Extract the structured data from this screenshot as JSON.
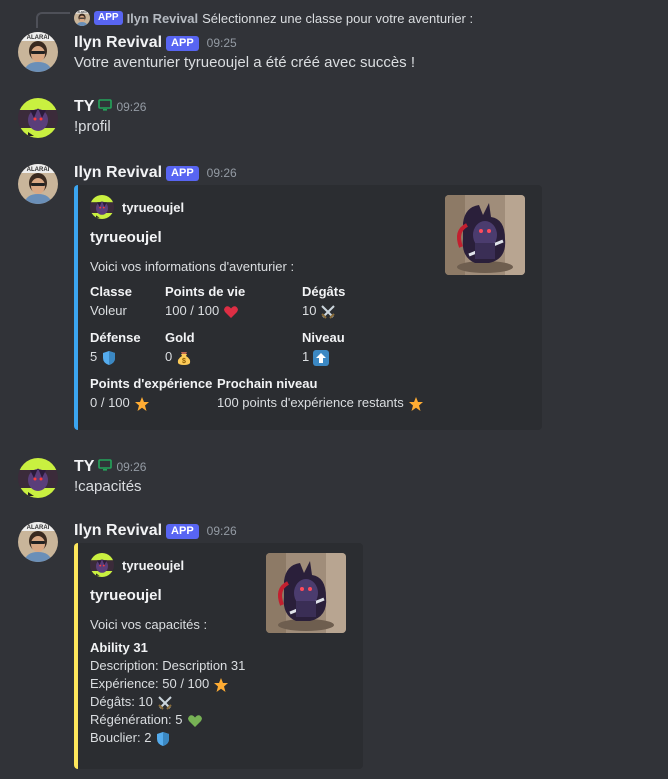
{
  "reply": {
    "author": "Ilyn Revival",
    "badge": "APP",
    "text": "Sélectionnez une classe pour votre aventurier :"
  },
  "messages": [
    {
      "author": "Ilyn Revival",
      "badge": "APP",
      "time": "09:25",
      "text": "Votre aventurier tyrueoujel a été créé avec succès !"
    },
    {
      "author": "TY",
      "time": "09:26",
      "text": "!profil",
      "icon": "monitor-icon"
    },
    {
      "author": "Ilyn Revival",
      "badge": "APP",
      "time": "09:26",
      "embed": {
        "author": "tyrueoujel",
        "title": "tyrueoujel",
        "description": "Voici vos informations d'aventurier :",
        "accent": "#3ba5f0",
        "fields": [
          {
            "name": "Classe",
            "value": "Voleur",
            "emoji": ""
          },
          {
            "name": "Points de vie",
            "value": "100 / 100",
            "emoji": "heart-icon"
          },
          {
            "name": "Dégâts",
            "value": "10",
            "emoji": "swords-icon"
          },
          {
            "name": "Défense",
            "value": "5",
            "emoji": "shield-icon"
          },
          {
            "name": "Gold",
            "value": "0",
            "emoji": "money-bag-icon"
          },
          {
            "name": "Niveau",
            "value": "1",
            "emoji": "up-arrow-icon"
          },
          {
            "name": "Points d'expérience",
            "value": "0 / 100",
            "emoji": "star-icon"
          },
          {
            "name": "Prochain niveau",
            "value": "100 points d'expérience restants",
            "emoji": "star-icon"
          }
        ]
      }
    },
    {
      "author": "TY",
      "time": "09:26",
      "text": "!capacités",
      "icon": "monitor-icon"
    },
    {
      "author": "Ilyn Revival",
      "badge": "APP",
      "time": "09:26",
      "embed": {
        "author": "tyrueoujel",
        "title": "tyrueoujel",
        "description": "Voici vos capacités :",
        "accent": "#fee75c",
        "lines": [
          {
            "text": "Ability 31",
            "bold": true,
            "emoji": ""
          },
          {
            "text": "Description: Description 31",
            "bold": false,
            "emoji": ""
          },
          {
            "text": "Expérience: 50 / 100",
            "bold": false,
            "emoji": "star-icon"
          },
          {
            "text": "Dégâts: 10",
            "bold": false,
            "emoji": "swords-icon"
          },
          {
            "text": "Régénération: 5",
            "bold": false,
            "emoji": "green-heart-icon"
          },
          {
            "text": "Bouclier: 2",
            "bold": false,
            "emoji": "shield-icon"
          }
        ]
      }
    }
  ],
  "colors": {
    "background": "#313338",
    "embed_background": "#2b2d31",
    "app_badge": "#5865f2",
    "online_monitor": "#23a55a"
  }
}
